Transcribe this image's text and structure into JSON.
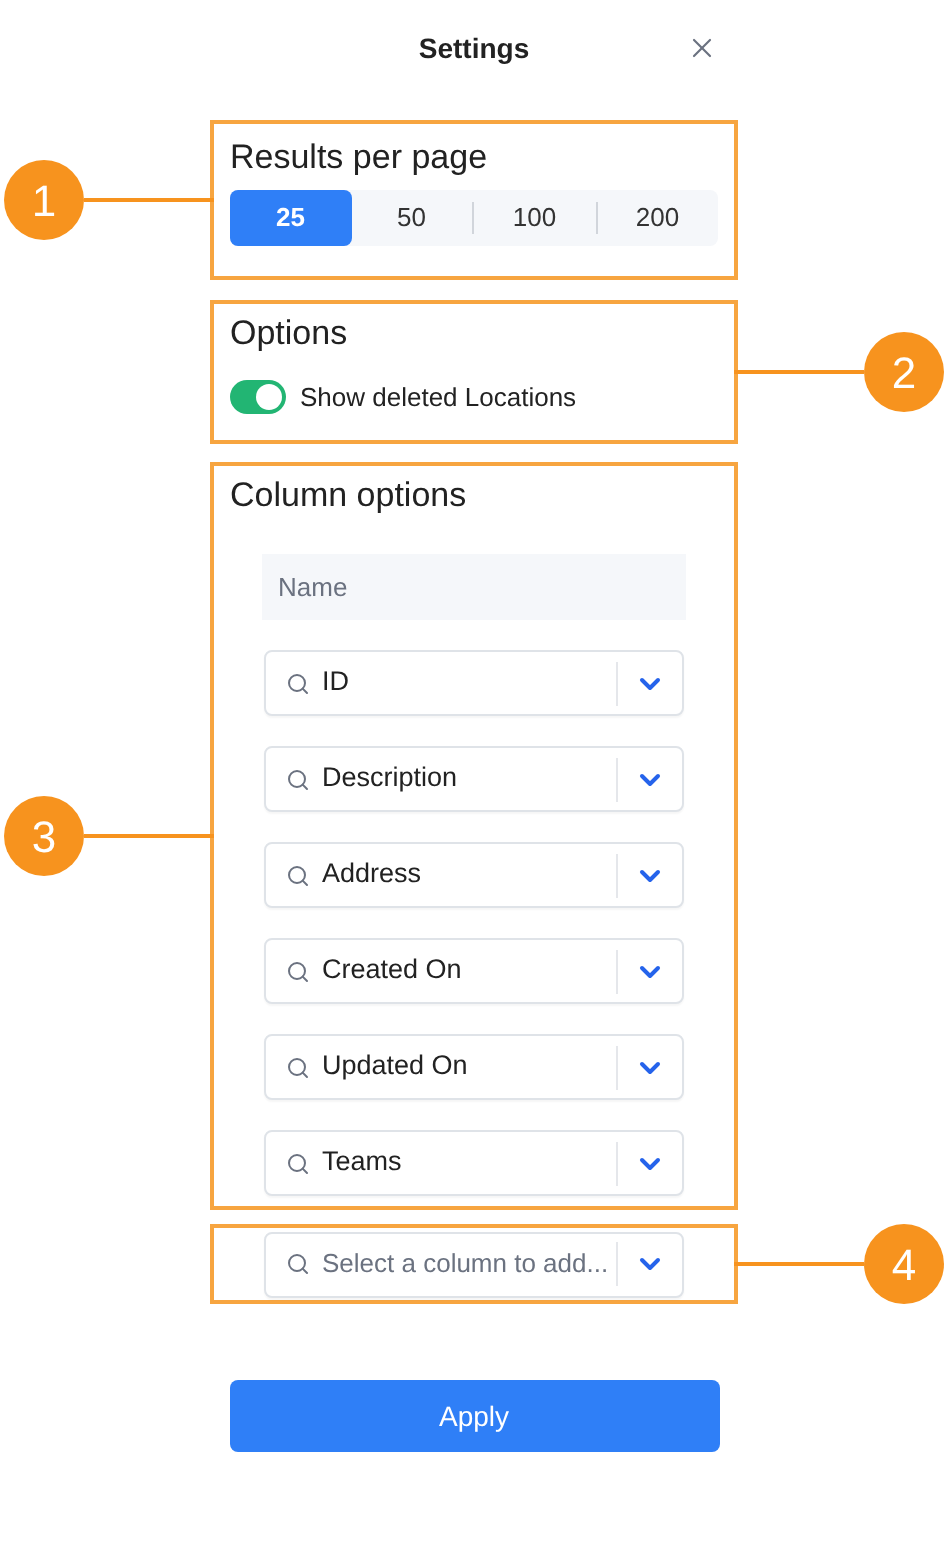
{
  "title": "Settings",
  "results_per_page": {
    "heading": "Results per page",
    "callout": {
      "label": "1",
      "kind": "left"
    },
    "options": [
      {
        "label": "25",
        "selected": true
      },
      {
        "label": "50",
        "selected": false
      },
      {
        "label": "100",
        "selected": false
      },
      {
        "label": "200",
        "selected": false
      }
    ]
  },
  "options": {
    "heading": "Options",
    "callout": {
      "label": "2",
      "kind": "right"
    },
    "toggle": {
      "label": "Show deleted Locations",
      "on": true
    }
  },
  "column_options": {
    "heading": "Column options",
    "callout": {
      "label": "3",
      "kind": "left"
    },
    "fixed_column": "Name",
    "columns": [
      "ID",
      "Description",
      "Address",
      "Created On",
      "Updated On",
      "Teams"
    ]
  },
  "add_column": {
    "placeholder": "Select a column to add...",
    "callout": {
      "label": "4",
      "kind": "right"
    }
  },
  "apply_button": "Apply"
}
